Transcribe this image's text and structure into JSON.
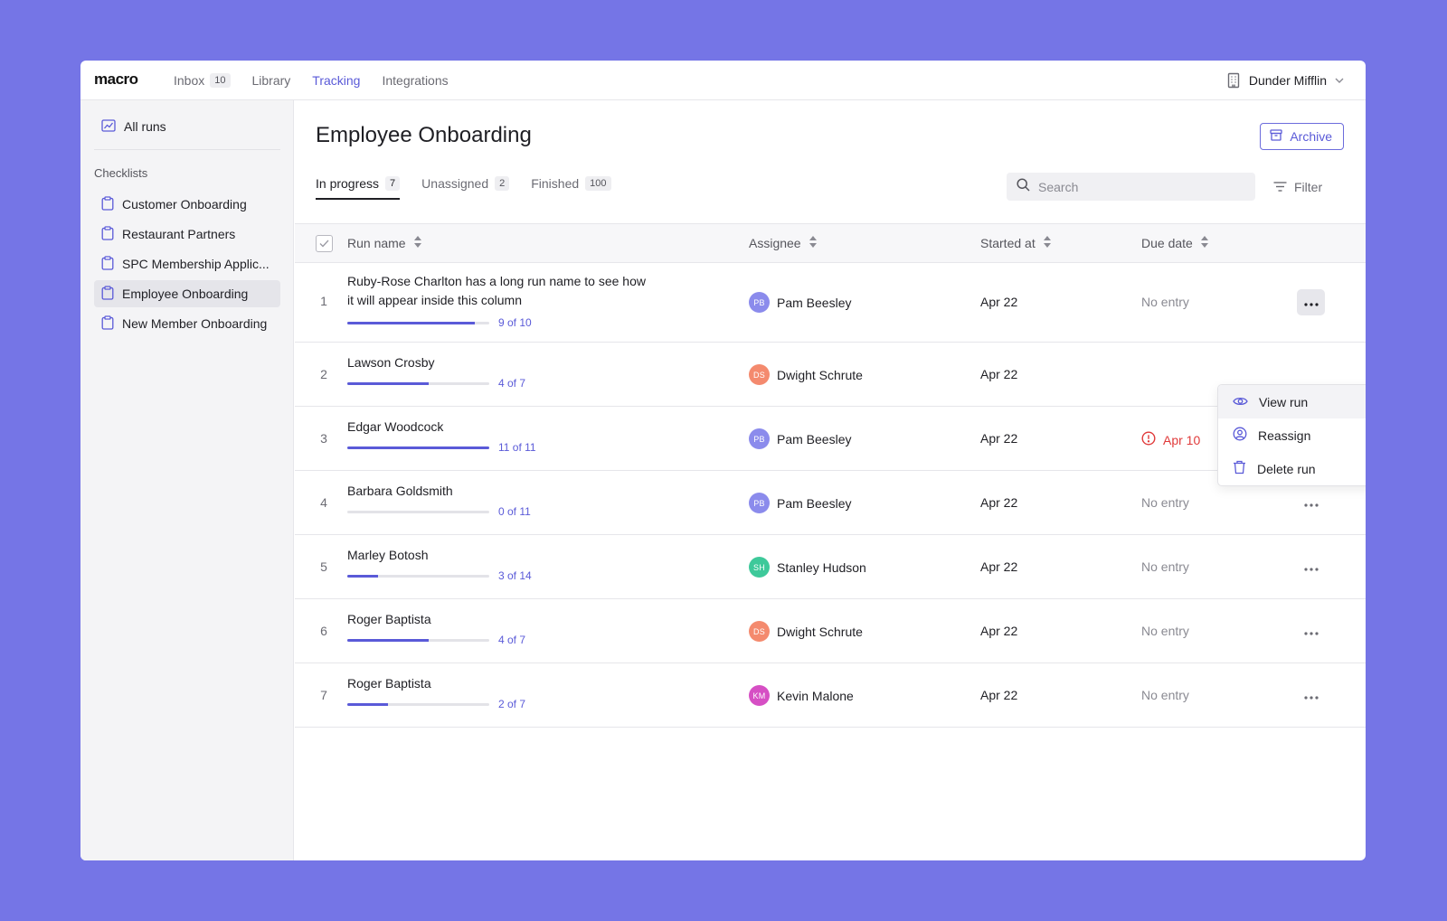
{
  "app": {
    "logo": "macro"
  },
  "nav": {
    "items": [
      {
        "label": "Inbox",
        "badge": "10"
      },
      {
        "label": "Library"
      },
      {
        "label": "Tracking",
        "active": true
      },
      {
        "label": "Integrations"
      }
    ],
    "org": "Dunder Mifflin"
  },
  "sidebar": {
    "all_runs": "All runs",
    "heading": "Checklists",
    "items": [
      {
        "label": "Customer Onboarding"
      },
      {
        "label": "Restaurant Partners"
      },
      {
        "label": "SPC Membership Applic..."
      },
      {
        "label": "Employee Onboarding",
        "selected": true
      },
      {
        "label": "New Member Onboarding"
      }
    ]
  },
  "page": {
    "title": "Employee Onboarding",
    "archive_label": "Archive",
    "tabs": [
      {
        "label": "In progress",
        "count": "7",
        "active": true
      },
      {
        "label": "Unassigned",
        "count": "2"
      },
      {
        "label": "Finished",
        "count": "100"
      }
    ],
    "search_placeholder": "Search",
    "filter_label": "Filter"
  },
  "table": {
    "columns": {
      "run_name": "Run name",
      "assignee": "Assignee",
      "started_at": "Started at",
      "due_date": "Due date"
    },
    "rows": [
      {
        "num": "1",
        "name": "Ruby-Rose Charlton has a long run name to see how it will appear inside this column",
        "progress": 0.9,
        "progress_text": "9 of 10",
        "assignee": "Pam Beesley",
        "initials": "PB",
        "avatar_color": "#8b8bec",
        "started": "Apr 22",
        "due": "No entry",
        "overdue": false
      },
      {
        "num": "2",
        "name": "Lawson Crosby",
        "progress": 0.571,
        "progress_text": "4 of 7",
        "assignee": "Dwight Schrute",
        "initials": "DS",
        "avatar_color": "#f48a6e",
        "started": "Apr 22",
        "due": "",
        "overdue": false
      },
      {
        "num": "3",
        "name": "Edgar Woodcock",
        "progress": 1.0,
        "progress_text": "11 of 11",
        "assignee": "Pam Beesley",
        "initials": "PB",
        "avatar_color": "#8b8bec",
        "started": "Apr 22",
        "due": "Apr 10",
        "overdue": true
      },
      {
        "num": "4",
        "name": "Barbara Goldsmith",
        "progress": 0.0,
        "progress_text": "0 of 11",
        "assignee": "Pam Beesley",
        "initials": "PB",
        "avatar_color": "#8b8bec",
        "started": "Apr 22",
        "due": "No entry",
        "overdue": false
      },
      {
        "num": "5",
        "name": "Marley Botosh",
        "progress": 0.214,
        "progress_text": "3 of 14",
        "assignee": "Stanley Hudson",
        "initials": "SH",
        "avatar_color": "#3ec99a",
        "started": "Apr 22",
        "due": "No entry",
        "overdue": false
      },
      {
        "num": "6",
        "name": "Roger Baptista",
        "progress": 0.571,
        "progress_text": "4 of 7",
        "assignee": "Dwight Schrute",
        "initials": "DS",
        "avatar_color": "#f48a6e",
        "started": "Apr 22",
        "due": "No entry",
        "overdue": false
      },
      {
        "num": "7",
        "name": "Roger Baptista",
        "progress": 0.286,
        "progress_text": "2 of 7",
        "assignee": "Kevin Malone",
        "initials": "KM",
        "avatar_color": "#d64fc4",
        "started": "Apr 22",
        "due": "No entry",
        "overdue": false
      }
    ]
  },
  "context_menu": {
    "items": [
      {
        "label": "View run",
        "icon": "eye-icon"
      },
      {
        "label": "Reassign",
        "icon": "user-circle-icon"
      },
      {
        "label": "Delete run",
        "icon": "trash-icon"
      }
    ]
  },
  "colors": {
    "accent": "#5a5ad8",
    "background": "#7575e6",
    "overdue": "#e03a3a"
  }
}
